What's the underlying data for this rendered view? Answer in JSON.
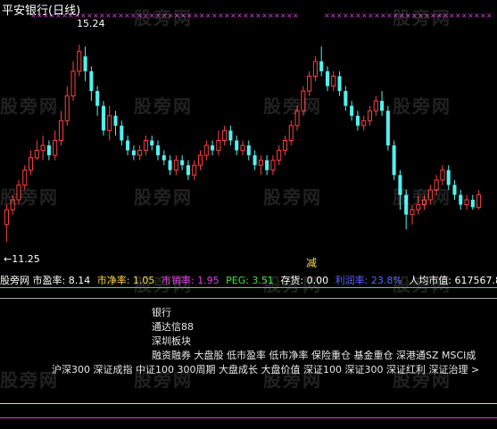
{
  "title": "平安银行(日线)",
  "watermark": "股旁网",
  "colors": {
    "up": "#ff4040",
    "down": "#54f0f0",
    "marker": "#e040e0",
    "yellow": "#ffd84c",
    "green": "#44e044",
    "magenta": "#e040e0",
    "blue": "#6060ff",
    "white": "#ffffff"
  },
  "labels": {
    "high": "15.24",
    "low": "←11.25",
    "signal": "减"
  },
  "chart_data": {
    "type": "candlestick",
    "title": "平安银行(日线)",
    "high_label": 15.24,
    "low_label": 11.25,
    "ylim": [
      11.0,
      15.6
    ],
    "candles": [
      {
        "o": 11.6,
        "c": 11.9,
        "h": 12.0,
        "l": 11.25
      },
      {
        "o": 11.9,
        "c": 12.1,
        "h": 12.2,
        "l": 11.8
      },
      {
        "o": 12.1,
        "c": 12.4,
        "h": 12.5,
        "l": 12.0
      },
      {
        "o": 12.4,
        "c": 12.7,
        "h": 12.8,
        "l": 12.3
      },
      {
        "o": 12.7,
        "c": 12.95,
        "h": 13.1,
        "l": 12.6
      },
      {
        "o": 12.95,
        "c": 13.1,
        "h": 13.3,
        "l": 12.9
      },
      {
        "o": 13.1,
        "c": 13.2,
        "h": 13.4,
        "l": 12.9
      },
      {
        "o": 13.2,
        "c": 13.0,
        "h": 13.3,
        "l": 12.9
      },
      {
        "o": 13.0,
        "c": 13.3,
        "h": 13.5,
        "l": 12.9
      },
      {
        "o": 13.3,
        "c": 13.7,
        "h": 13.9,
        "l": 13.2
      },
      {
        "o": 13.7,
        "c": 14.2,
        "h": 14.4,
        "l": 13.6
      },
      {
        "o": 14.2,
        "c": 14.7,
        "h": 14.9,
        "l": 14.1
      },
      {
        "o": 14.7,
        "c": 15.1,
        "h": 15.24,
        "l": 14.6
      },
      {
        "o": 15.0,
        "c": 14.7,
        "h": 15.2,
        "l": 14.5
      },
      {
        "o": 14.7,
        "c": 14.3,
        "h": 14.8,
        "l": 14.1
      },
      {
        "o": 14.3,
        "c": 14.0,
        "h": 14.4,
        "l": 13.8
      },
      {
        "o": 14.0,
        "c": 13.5,
        "h": 14.1,
        "l": 13.4
      },
      {
        "o": 13.5,
        "c": 13.8,
        "h": 14.0,
        "l": 13.3
      },
      {
        "o": 13.8,
        "c": 13.6,
        "h": 13.9,
        "l": 13.4
      },
      {
        "o": 13.6,
        "c": 13.3,
        "h": 13.7,
        "l": 13.2
      },
      {
        "o": 13.3,
        "c": 13.1,
        "h": 13.4,
        "l": 13.0
      },
      {
        "o": 13.1,
        "c": 13.0,
        "h": 13.2,
        "l": 12.9
      },
      {
        "o": 13.0,
        "c": 13.1,
        "h": 13.2,
        "l": 12.9
      },
      {
        "o": 13.1,
        "c": 13.3,
        "h": 13.4,
        "l": 13.0
      },
      {
        "o": 13.3,
        "c": 13.2,
        "h": 13.4,
        "l": 13.1
      },
      {
        "o": 13.2,
        "c": 13.0,
        "h": 13.3,
        "l": 12.9
      },
      {
        "o": 13.0,
        "c": 12.9,
        "h": 13.1,
        "l": 12.8
      },
      {
        "o": 12.9,
        "c": 12.7,
        "h": 13.0,
        "l": 12.6
      },
      {
        "o": 12.7,
        "c": 12.9,
        "h": 13.0,
        "l": 12.6
      },
      {
        "o": 12.9,
        "c": 12.8,
        "h": 13.0,
        "l": 12.7
      },
      {
        "o": 12.8,
        "c": 12.6,
        "h": 12.9,
        "l": 12.5
      },
      {
        "o": 12.6,
        "c": 12.8,
        "h": 12.9,
        "l": 12.5
      },
      {
        "o": 12.8,
        "c": 13.0,
        "h": 13.1,
        "l": 12.7
      },
      {
        "o": 13.0,
        "c": 13.2,
        "h": 13.3,
        "l": 12.9
      },
      {
        "o": 13.2,
        "c": 13.1,
        "h": 13.3,
        "l": 13.0
      },
      {
        "o": 13.1,
        "c": 13.3,
        "h": 13.5,
        "l": 13.0
      },
      {
        "o": 13.3,
        "c": 13.5,
        "h": 13.6,
        "l": 13.2
      },
      {
        "o": 13.5,
        "c": 13.3,
        "h": 13.6,
        "l": 13.2
      },
      {
        "o": 13.3,
        "c": 13.1,
        "h": 13.4,
        "l": 13.0
      },
      {
        "o": 13.1,
        "c": 13.2,
        "h": 13.3,
        "l": 13.0
      },
      {
        "o": 13.2,
        "c": 13.0,
        "h": 13.3,
        "l": 12.9
      },
      {
        "o": 13.0,
        "c": 12.8,
        "h": 13.1,
        "l": 12.7
      },
      {
        "o": 12.8,
        "c": 12.9,
        "h": 13.0,
        "l": 12.6
      },
      {
        "o": 12.9,
        "c": 12.7,
        "h": 13.0,
        "l": 12.6
      },
      {
        "o": 12.7,
        "c": 12.9,
        "h": 13.0,
        "l": 12.6
      },
      {
        "o": 12.9,
        "c": 13.1,
        "h": 13.2,
        "l": 12.8
      },
      {
        "o": 13.1,
        "c": 13.3,
        "h": 13.4,
        "l": 13.0
      },
      {
        "o": 13.3,
        "c": 13.6,
        "h": 13.7,
        "l": 13.2
      },
      {
        "o": 13.6,
        "c": 13.9,
        "h": 14.0,
        "l": 13.5
      },
      {
        "o": 13.9,
        "c": 14.3,
        "h": 14.4,
        "l": 13.8
      },
      {
        "o": 14.3,
        "c": 14.6,
        "h": 14.7,
        "l": 14.2
      },
      {
        "o": 14.6,
        "c": 14.9,
        "h": 15.0,
        "l": 14.5
      },
      {
        "o": 14.9,
        "c": 14.7,
        "h": 15.2,
        "l": 14.6
      },
      {
        "o": 14.7,
        "c": 14.4,
        "h": 14.8,
        "l": 14.3
      },
      {
        "o": 14.4,
        "c": 14.6,
        "h": 14.7,
        "l": 14.3
      },
      {
        "o": 14.6,
        "c": 14.3,
        "h": 14.7,
        "l": 14.2
      },
      {
        "o": 14.3,
        "c": 14.0,
        "h": 14.4,
        "l": 13.9
      },
      {
        "o": 14.0,
        "c": 13.8,
        "h": 14.1,
        "l": 13.7
      },
      {
        "o": 13.8,
        "c": 13.6,
        "h": 13.9,
        "l": 13.5
      },
      {
        "o": 13.6,
        "c": 13.7,
        "h": 13.8,
        "l": 13.5
      },
      {
        "o": 13.7,
        "c": 13.9,
        "h": 14.0,
        "l": 13.6
      },
      {
        "o": 13.9,
        "c": 14.1,
        "h": 14.2,
        "l": 13.8
      },
      {
        "o": 14.1,
        "c": 13.9,
        "h": 14.3,
        "l": 13.8
      },
      {
        "o": 13.9,
        "c": 13.2,
        "h": 14.0,
        "l": 13.1
      },
      {
        "o": 13.2,
        "c": 12.6,
        "h": 13.3,
        "l": 12.5
      },
      {
        "o": 12.6,
        "c": 12.2,
        "h": 12.7,
        "l": 11.9
      },
      {
        "o": 12.2,
        "c": 11.8,
        "h": 12.3,
        "l": 11.5
      },
      {
        "o": 11.8,
        "c": 11.9,
        "h": 12.0,
        "l": 11.6
      },
      {
        "o": 11.9,
        "c": 12.0,
        "h": 12.2,
        "l": 11.8
      },
      {
        "o": 12.0,
        "c": 12.1,
        "h": 12.2,
        "l": 11.9
      },
      {
        "o": 12.1,
        "c": 12.3,
        "h": 12.4,
        "l": 12.0
      },
      {
        "o": 12.3,
        "c": 12.5,
        "h": 12.6,
        "l": 12.2
      },
      {
        "o": 12.5,
        "c": 12.7,
        "h": 12.8,
        "l": 12.4
      },
      {
        "o": 12.7,
        "c": 12.4,
        "h": 12.8,
        "l": 12.3
      },
      {
        "o": 12.4,
        "c": 12.2,
        "h": 12.5,
        "l": 12.1
      },
      {
        "o": 12.2,
        "c": 12.0,
        "h": 12.3,
        "l": 11.9
      },
      {
        "o": 12.0,
        "c": 12.1,
        "h": 12.2,
        "l": 11.9
      },
      {
        "o": 12.1,
        "c": 11.95,
        "h": 12.2,
        "l": 11.9
      },
      {
        "o": 11.95,
        "c": 12.2,
        "h": 12.3,
        "l": 11.9
      }
    ]
  },
  "indicators": [
    {
      "label": "股旁网 市盈率: 8.14",
      "color": "#ffffff"
    },
    {
      "label": "市净率: 1.05",
      "color": "#ffd84c"
    },
    {
      "label": "市销率: 1.95",
      "color": "#e040e0"
    },
    {
      "label": "PEG: 3.51",
      "color": "#44e044"
    },
    {
      "label": "存货: 0.00",
      "color": "#ffffff"
    },
    {
      "label": "利润率: 23.8%",
      "color": "#6060ff"
    },
    {
      "label": "人均市值: 617567.8",
      "color": "#ffffff"
    }
  ],
  "sectors": [
    "银行",
    "通达信88",
    "深圳板块",
    "融资融券 大盘股 低市盈率 低市净率 保险重仓 基金重仓 深港通SZ MSCI成",
    "沪深300 深证成指 中证100 300周期 大盘成长 大盘价值 深证100 深证300 深证红利 深证治理 >"
  ]
}
